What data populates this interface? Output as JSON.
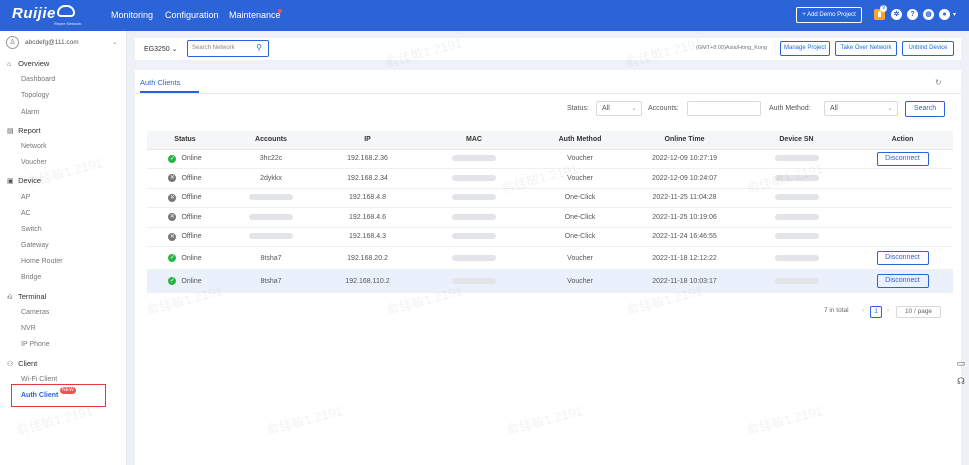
{
  "topbar": {
    "brand": "Ruijie",
    "brand_sub": "Reyee Network",
    "nav": [
      "Monitoring",
      "Configuration",
      "Maintenance"
    ],
    "demo_button": "+ Add Demo Project",
    "notif_count": "9",
    "icons": [
      "bell-icon",
      "gear-icon",
      "help-icon",
      "globe-icon",
      "user-icon"
    ]
  },
  "sidebar": {
    "account": "abcdefg@111.com",
    "groups": [
      {
        "label": "Overview",
        "icon": "home-icon",
        "items": [
          "Dashboard",
          "Topology",
          "Alarm"
        ]
      },
      {
        "label": "Report",
        "icon": "report-icon",
        "items": [
          "Network",
          "Voucher"
        ]
      },
      {
        "label": "Device",
        "icon": "device-icon",
        "items": [
          "AP",
          "AC",
          "Switch",
          "Gateway",
          "Home Router",
          "Bridge"
        ]
      },
      {
        "label": "Terminal",
        "icon": "terminal-icon",
        "items": [
          "Cameras",
          "NVR",
          "IP Phone"
        ]
      },
      {
        "label": "Client",
        "icon": "client-icon",
        "items": [
          "Wi-Fi Client",
          "Auth Client"
        ]
      }
    ],
    "new_tag": "NEW"
  },
  "filterbar": {
    "device": "EG3250",
    "search_placeholder": "Search Network",
    "timezone": "(GMT+8:00)Asia/Hong_Kong",
    "buttons": [
      "Manage Project",
      "Take Over Network",
      "Unbind Device"
    ]
  },
  "panel": {
    "tab": "Auth Clients",
    "filters": {
      "status_label": "Status:",
      "status_value": "All",
      "accounts_label": "Accounts:",
      "accounts_value": "",
      "method_label": "Auth Method:",
      "method_value": "All",
      "search_button": "Search"
    },
    "columns": [
      "Status",
      "Accounts",
      "IP",
      "MAC",
      "Auth Method",
      "Online Time",
      "Device SN",
      "Action"
    ],
    "rows": [
      {
        "status": "Online",
        "account": "3hc22c",
        "ip": "192.168.2.36",
        "method": "Voucher",
        "time": "2022-12-09 10:27:19",
        "action": "Disconnect"
      },
      {
        "status": "Offline",
        "account": "2dykkx",
        "ip": "192.168.2.34",
        "method": "Voucher",
        "time": "2022-12-09 10:24:07",
        "action": ""
      },
      {
        "status": "Offline",
        "account": "",
        "ip": "192.168.4.8",
        "method": "One-Click",
        "time": "2022-11-25 11:04:28",
        "action": ""
      },
      {
        "status": "Offline",
        "account": "",
        "ip": "192.168.4.6",
        "method": "One-Click",
        "time": "2022-11-25 10:19:06",
        "action": ""
      },
      {
        "status": "Offline",
        "account": "",
        "ip": "192.168.4.3",
        "method": "One-Click",
        "time": "2022-11-24 16:46:55",
        "action": ""
      },
      {
        "status": "Online",
        "account": "8tsha7",
        "ip": "192.168.20.2",
        "method": "Voucher",
        "time": "2022-11-18 12:12:22",
        "action": "Disconnect"
      },
      {
        "status": "Online",
        "account": "8tsha7",
        "ip": "192.168.110.2",
        "method": "Voucher",
        "time": "2022-11-18 10:03:17",
        "action": "Disconnect"
      }
    ],
    "pagination": {
      "total": "7 in total",
      "page": "1",
      "page_size": "10 / page"
    }
  },
  "watermark": "俞佳敏1 2191",
  "colors": {
    "primary": "#2b63d9",
    "online": "#28b446",
    "offline": "#777777",
    "alert": "#e53935"
  }
}
